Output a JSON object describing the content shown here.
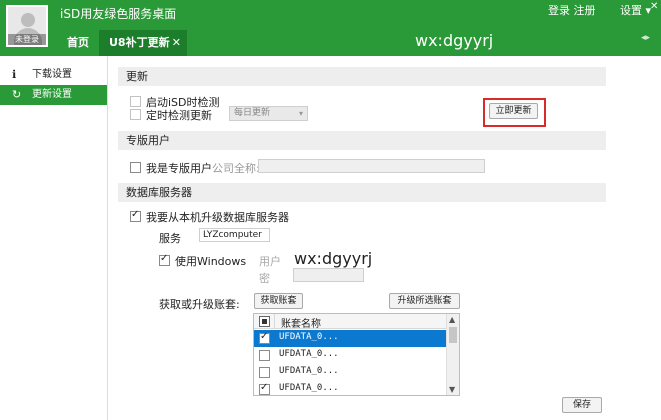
{
  "header": {
    "avatar_caption": "未登录",
    "app_title": "iSD用友绿色服务桌面",
    "login_register": "登录 注册",
    "settings": "设置",
    "settings_caret": "▾",
    "window_controls": "— ×",
    "tabs": [
      {
        "label": "首页"
      },
      {
        "label": "U8补丁更新",
        "close": "✕"
      }
    ],
    "center_title": "wx:dgyyrj",
    "nav_arrows": "◂▸"
  },
  "sidebar": {
    "items": [
      {
        "label": "下载设置",
        "icon": "ℹ"
      },
      {
        "label": "更新设置",
        "icon": "↻"
      }
    ]
  },
  "update": {
    "section_title": "更新",
    "auto_check_label": "启动iSD时检测",
    "timed_check_label": "定时检测更新",
    "frequency_value": "每日更新",
    "frequency_caret": "▾",
    "update_now_button": "立即更新"
  },
  "pro_user": {
    "section_title": "专版用户",
    "pro_user_label": "我是专版用户",
    "company_label": "公司全称:",
    "company_value": ""
  },
  "db_server": {
    "section_title": "数据库服务器",
    "upgrade_from_local_label": "我要从本机升级数据库服务器",
    "service_label": "服务",
    "service_value": "LYZcomputer",
    "use_windows_label": "使用Windows",
    "user_label": "用户",
    "password_label": "密",
    "user_value": "",
    "password_value": "",
    "watermark": "wx:dgyyrj",
    "get_upgrade_label": "获取或升级账套:",
    "get_accounts_button": "获取账套",
    "upgrade_selected_button": "升级所选账套",
    "table": {
      "header": "账套名称",
      "rows": [
        {
          "name": "UFDATA_0...",
          "checked": true,
          "selected": true
        },
        {
          "name": "UFDATA_0...",
          "checked": false,
          "selected": false
        },
        {
          "name": "UFDATA_0...",
          "checked": false,
          "selected": false
        },
        {
          "name": "UFDATA_0...",
          "checked": true,
          "selected": false
        }
      ],
      "scroll_up": "▲",
      "scroll_down": "▼"
    }
  },
  "footer": {
    "save_button": "保存"
  }
}
